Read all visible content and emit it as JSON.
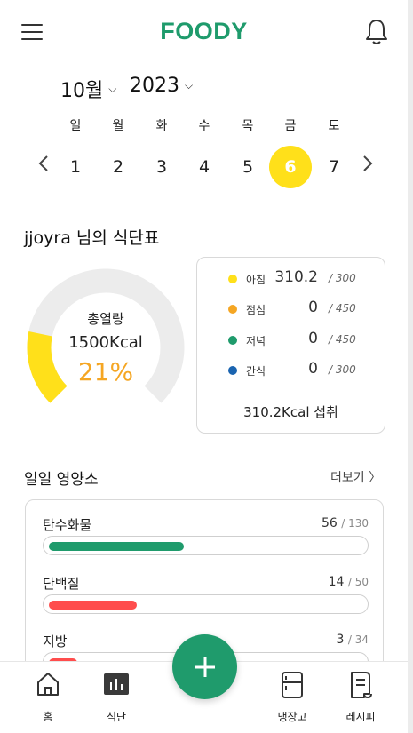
{
  "header": {
    "brand": "FOODY",
    "menu_icon": "hamburger-icon",
    "notify_icon": "bell-icon"
  },
  "calendar": {
    "month": "10월",
    "year": "2023",
    "weekdays": [
      "일",
      "월",
      "화",
      "수",
      "목",
      "금",
      "토"
    ],
    "days": [
      "1",
      "2",
      "3",
      "4",
      "5",
      "6",
      "7"
    ],
    "selected_day": "6",
    "prev_icon": "chevron-left-icon",
    "next_icon": "chevron-right-icon"
  },
  "plan": {
    "title": "jjoyra 님의 식단표",
    "donut": {
      "label": "총열량",
      "total": "1500Kcal",
      "percent_text": "21%",
      "fraction": 0.21,
      "fill_color": "#ffe01a",
      "track_color": "#ececec"
    },
    "meals": [
      {
        "name": "아침",
        "value": "310.2",
        "max": "/ 300",
        "color": "#ffe01a"
      },
      {
        "name": "점심",
        "value": "0",
        "max": "/ 450",
        "color": "#f5a623"
      },
      {
        "name": "저녁",
        "value": "0",
        "max": "/ 450",
        "color": "#1f9b6c"
      },
      {
        "name": "간식",
        "value": "0",
        "max": "/ 300",
        "color": "#1a64b0"
      }
    ],
    "total_intake": "310.2Kcal 섭취"
  },
  "nutrition": {
    "title": "일일 영양소",
    "more_label": "더보기 〉",
    "items": [
      {
        "name": "탄수화물",
        "value": "56",
        "max": "/ 130",
        "fraction": 0.43,
        "color": "#1f9b6c"
      },
      {
        "name": "단백질",
        "value": "14",
        "max": "/ 50",
        "fraction": 0.28,
        "color": "#ff4d4d"
      },
      {
        "name": "지방",
        "value": "3",
        "max": "/ 34",
        "fraction": 0.09,
        "color": "#ff4d4d"
      }
    ]
  },
  "bottom_nav": {
    "items": [
      {
        "label": "홈",
        "icon": "home-icon"
      },
      {
        "label": "식단",
        "icon": "chart-icon"
      },
      {
        "label": "냉장고",
        "icon": "fridge-icon"
      },
      {
        "label": "레시피",
        "icon": "recipe-icon"
      }
    ],
    "fab_icon": "plus-icon"
  }
}
